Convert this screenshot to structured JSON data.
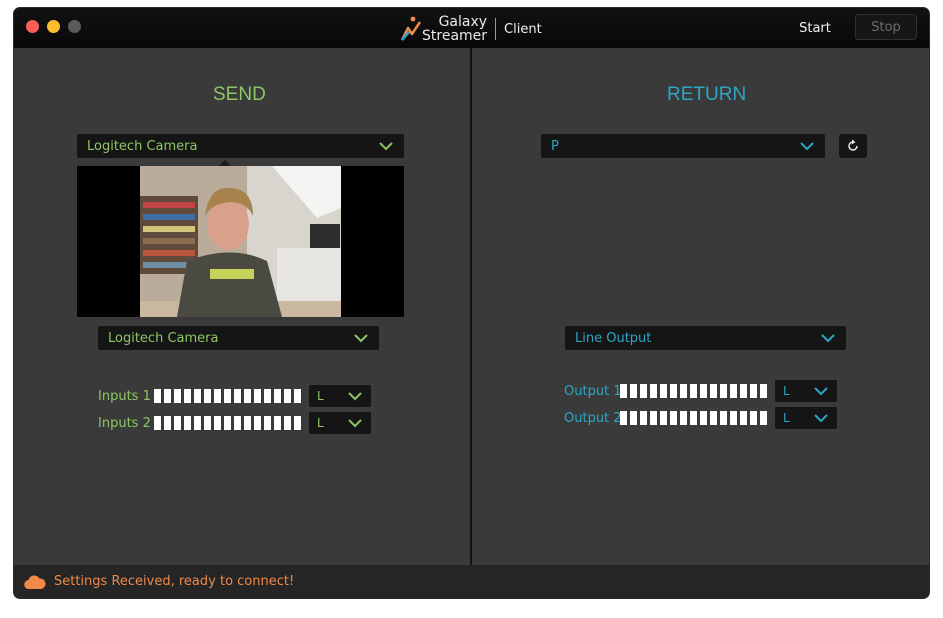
{
  "colors": {
    "send_accent": "#8dc665",
    "return_accent": "#2ba7c6",
    "status_accent": "#f0894a",
    "light_close": "#fc5f57",
    "light_min": "#fdbc2e",
    "light_zoom": "#5a5a5a"
  },
  "titlebar": {
    "brand_line1": "Galaxy",
    "brand_line2": "Streamer",
    "brand_suffix": "Client",
    "start_label": "Start",
    "stop_label": "Stop"
  },
  "send": {
    "title": "SEND",
    "video_source": "Logitech Camera",
    "audio_source": "Logitech Camera",
    "inputs": [
      {
        "label": "Inputs 1",
        "channel": "L"
      },
      {
        "label": "Inputs 2",
        "channel": "L"
      }
    ]
  },
  "return": {
    "title": "RETURN",
    "video_source": "P",
    "audio_output": "Line Output",
    "outputs": [
      {
        "label": "Output 1",
        "channel": "L"
      },
      {
        "label": "Output 2",
        "channel": "L"
      }
    ]
  },
  "status": {
    "icon": "cloud-icon",
    "message": "Settings Received, ready to connect!"
  }
}
